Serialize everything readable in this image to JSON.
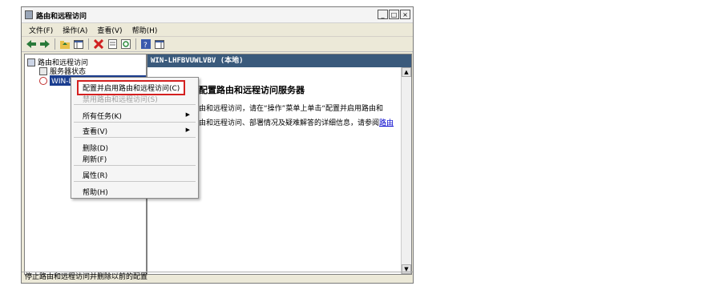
{
  "window": {
    "title": "路由和远程访问",
    "controls": {
      "minimize": "_",
      "maximize": "□",
      "close": "×"
    }
  },
  "menubar": {
    "items": [
      "文件(F)",
      "操作(A)",
      "查看(V)",
      "帮助(H)"
    ]
  },
  "toolbar": {
    "icons": [
      "back-arrow-icon",
      "forward-arrow-icon",
      "up-folder-icon",
      "console-tree-icon",
      "delete-icon",
      "properties-icon",
      "refresh-icon",
      "help-icon",
      "show-hide-icon"
    ]
  },
  "tree": {
    "root": "路由和远程访问",
    "server_status": "服务器状态",
    "server": "WIN-LHFBVUWLVBV (本地)"
  },
  "right_pane": {
    "header": "WIN-LHFBVUWLVBV (本地)",
    "heading": "配置路由和远程访问服务器",
    "line1": "由和远程访问，请在“操作”菜单上单击“配置并启用路由和",
    "line2": "由和远程访问、部署情况及疑难解答的详细信息，请参阅",
    "link_text": "路由"
  },
  "context_menu": {
    "configure": "配置并启用路由和远程访问(C)",
    "disable": "禁用路由和远程访问(S)",
    "all_tasks": "所有任务(K)",
    "view": "查看(V)",
    "delete": "删除(D)",
    "refresh": "刷新(F)",
    "properties": "属性(R)",
    "help": "帮助(H)",
    "submenu_arrow": "▶"
  },
  "statusbar": {
    "text": "停止路由和远程访问并删除以前的配置"
  },
  "colors": {
    "selection": "#1a3d8f",
    "pane_header": "#3a5a7c",
    "highlight_border": "#d42020",
    "link": "#0000cc"
  }
}
